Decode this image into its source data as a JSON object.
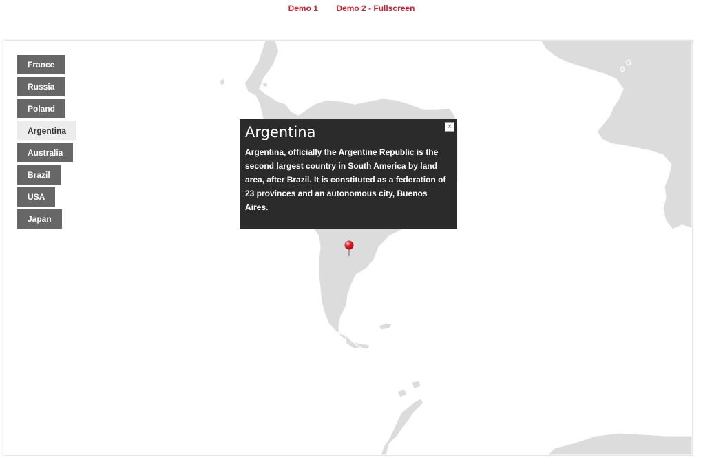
{
  "nav": {
    "links": [
      {
        "label": "Demo 1"
      },
      {
        "label": "Demo 2 - Fullscreen"
      }
    ]
  },
  "countries": [
    {
      "label": "France",
      "active": false
    },
    {
      "label": "Russia",
      "active": false
    },
    {
      "label": "Poland",
      "active": false
    },
    {
      "label": "Argentina",
      "active": true
    },
    {
      "label": "Australia",
      "active": false
    },
    {
      "label": "Brazil",
      "active": false
    },
    {
      "label": "USA",
      "active": false
    },
    {
      "label": "Japan",
      "active": false
    }
  ],
  "popup": {
    "title": "Argentina",
    "text": "Argentina, officially the Argentine Republic is the second largest country in South America by land area, after Brazil. It is constituted as a federation of 23 provinces and an autonomous city, Buenos Aires.",
    "close_label": "×"
  },
  "marker": {
    "icon": "map-pin-icon",
    "color": "#e0272f"
  },
  "colors": {
    "link": "#c8262f",
    "button": "#676767",
    "button_active": "#ececec",
    "land": "#dcdcdc",
    "popup_bg": "#2b2b2b"
  }
}
